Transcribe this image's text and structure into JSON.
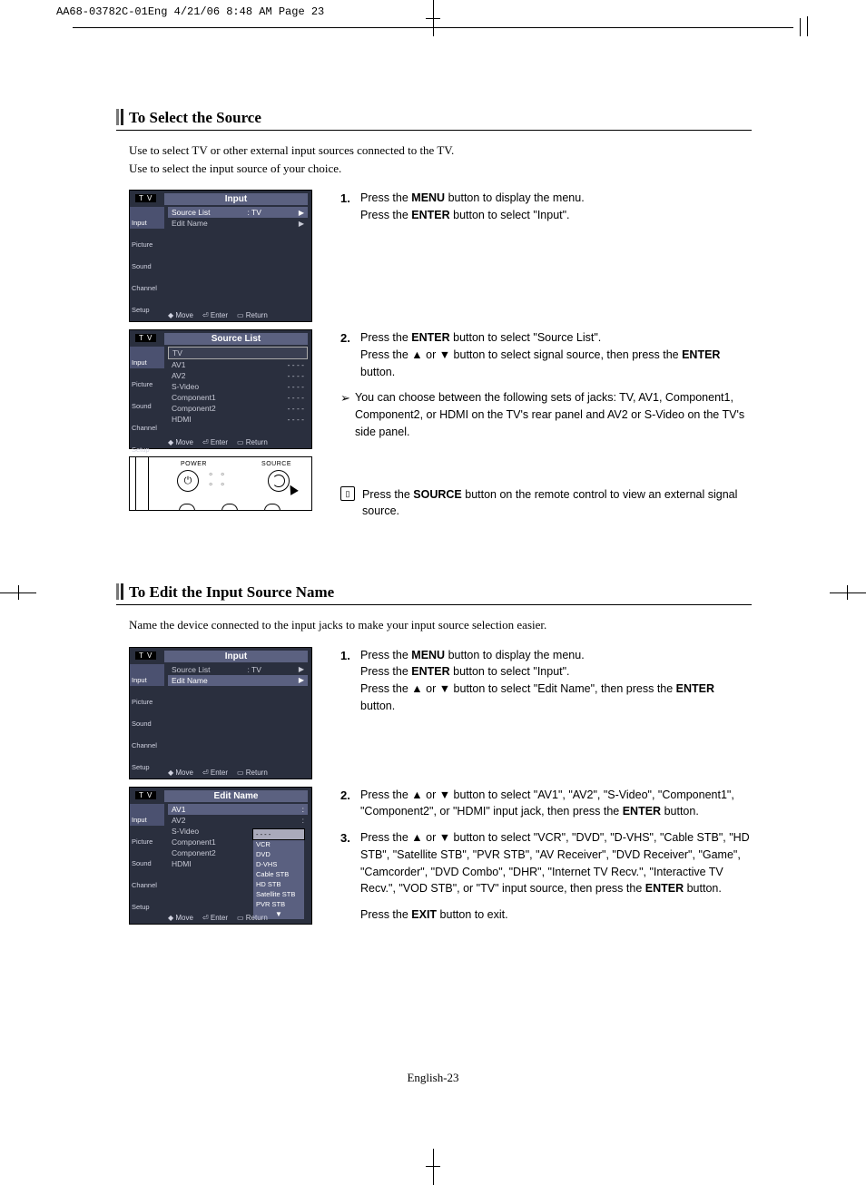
{
  "print_header": "AA68-03782C-01Eng  4/21/06  8:48 AM  Page 23",
  "section1": {
    "title": "To Select the Source",
    "intro1": "Use to select TV or other external input sources connected to the TV.",
    "intro2": "Use to select the input source of your choice.",
    "step1_num": "1.",
    "step1_a": "Press the ",
    "step1_b": "MENU",
    "step1_c": " button to display the menu.",
    "step1_d": "Press the ",
    "step1_e": "ENTER",
    "step1_f": " button to select \"Input\".",
    "step2_num": "2.",
    "step2_a": "Press the ",
    "step2_b": "ENTER",
    "step2_c": " button to select \"Source List\".",
    "step2_d": "Press the ▲ or ▼ button to select signal source, then press the ",
    "step2_e": "ENTER",
    "step2_f": " button.",
    "note_arrow": "➢",
    "note_text": "You can choose between the following sets of jacks: TV, AV1, Component1, Component2, or HDMI on the TV's rear panel and AV2 or S-Video on the TV's side panel.",
    "remote_note_a": "Press the ",
    "remote_note_b": "SOURCE",
    "remote_note_c": " button on the remote control to view an external signal source."
  },
  "section2": {
    "title": "To Edit the Input Source Name",
    "intro": "Name the device connected to the input jacks to make your input source selection easier.",
    "step1_num": "1.",
    "step1_a": "Press the ",
    "step1_b": "MENU",
    "step1_c": " button to display the menu.",
    "step1_d": "Press the ",
    "step1_e": "ENTER",
    "step1_f": " button to select \"Input\".",
    "step1_g": "Press the ▲ or ▼ button to select \"Edit Name\", then press the ",
    "step1_h": "ENTER",
    "step1_i": " button.",
    "step2_num": "2.",
    "step2_a": "Press the ▲ or ▼ button to select \"AV1\", \"AV2\", \"S-Video\", \"Component1\", \"Component2\", or \"HDMI\" input jack, then press the ",
    "step2_b": "ENTER",
    "step2_c": " button.",
    "step3_num": "3.",
    "step3_a": "Press the ▲ or ▼ button to select \"VCR\", \"DVD\", \"D-VHS\", \"Cable STB\", \"HD STB\", \"Satellite STB\", \"PVR STB\", \"AV Receiver\", \"DVD Receiver\", \"Game\", \"Camcorder\", \"DVD Combo\", \"DHR\", \"Internet TV Recv.\", \"Interactive TV Recv.\", \"VOD STB\", or \"TV\" input source, then press the ",
    "step3_b": "ENTER",
    "step3_c": " button.",
    "step3_d": "Press the ",
    "step3_e": "EXIT",
    "step3_f": " button to exit."
  },
  "osd_common": {
    "tv": "T V",
    "side_input": "Input",
    "side_picture": "Picture",
    "side_sound": "Sound",
    "side_channel": "Channel",
    "side_setup": "Setup",
    "foot_move": "Move",
    "foot_enter": "Enter",
    "foot_return": "Return",
    "updown": "◆"
  },
  "osd1": {
    "title": "Input",
    "r1a": "Source List",
    "r1b": ": TV",
    "r2a": "Edit Name",
    "arrow": "▶"
  },
  "osd2": {
    "title": "Source List",
    "r1": "TV",
    "r2": "AV1",
    "r2b": "- - - -",
    "r3": "AV2",
    "r3b": "- - - -",
    "r4": "S-Video",
    "r4b": "- - - -",
    "r5": "Component1",
    "r5b": "- - - -",
    "r6": "Component2",
    "r6b": "- - - -",
    "r7": "HDMI",
    "r7b": "- - - -"
  },
  "osd3": {
    "title": "Input",
    "r1a": "Source List",
    "r1b": ": TV",
    "r2a": "Edit Name",
    "arrow": "▶"
  },
  "osd4": {
    "title": "Edit Name",
    "r1": "AV1",
    "c": ":",
    "r2": "AV2",
    "r3": "S-Video",
    "r4": "Component1",
    "r5": "Component2",
    "r6": "HDMI",
    "d0": "- - - -",
    "d1": "VCR",
    "d2": "DVD",
    "d3": "D-VHS",
    "d4": "Cable STB",
    "d5": "HD STB",
    "d6": "Satellite STB",
    "d7": "PVR STB",
    "darrow": "▼"
  },
  "remote": {
    "power": "POWER",
    "source": "SOURCE",
    "power_icon": "⏻"
  },
  "pagenum": "English-23"
}
